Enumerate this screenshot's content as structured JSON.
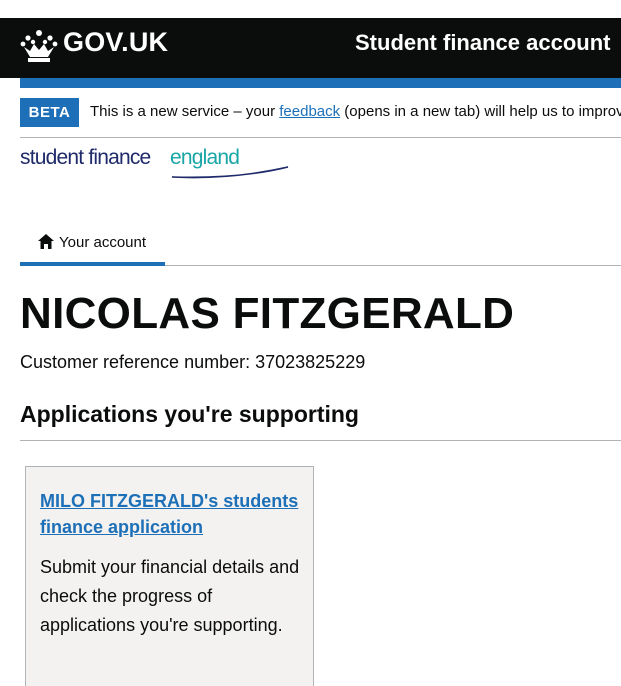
{
  "header": {
    "logo_text": "GOV.UK",
    "service_name": "Student finance account"
  },
  "phase_banner": {
    "tag": "BETA",
    "message_before": "This is a new service – your ",
    "feedback_link": "feedback",
    "message_after": " (opens in a new tab) will help us to improve it."
  },
  "brand": {
    "part1": "student finance",
    "part2": "england"
  },
  "nav": {
    "tab_label": "Your account"
  },
  "account": {
    "name": "NICOLAS FITZGERALD",
    "reference_label": "Customer reference number: ",
    "reference_number": "37023825229"
  },
  "supporting": {
    "title": "Applications you're supporting",
    "cards": [
      {
        "link": "MILO FITZGERALD's students finance application",
        "description": "Submit your financial details and check the progress of applications you're supporting."
      }
    ]
  },
  "colors": {
    "header_bg": "#0b0c0c",
    "brand_blue": "#1d70b8",
    "card_bg": "#f3f2f1"
  }
}
